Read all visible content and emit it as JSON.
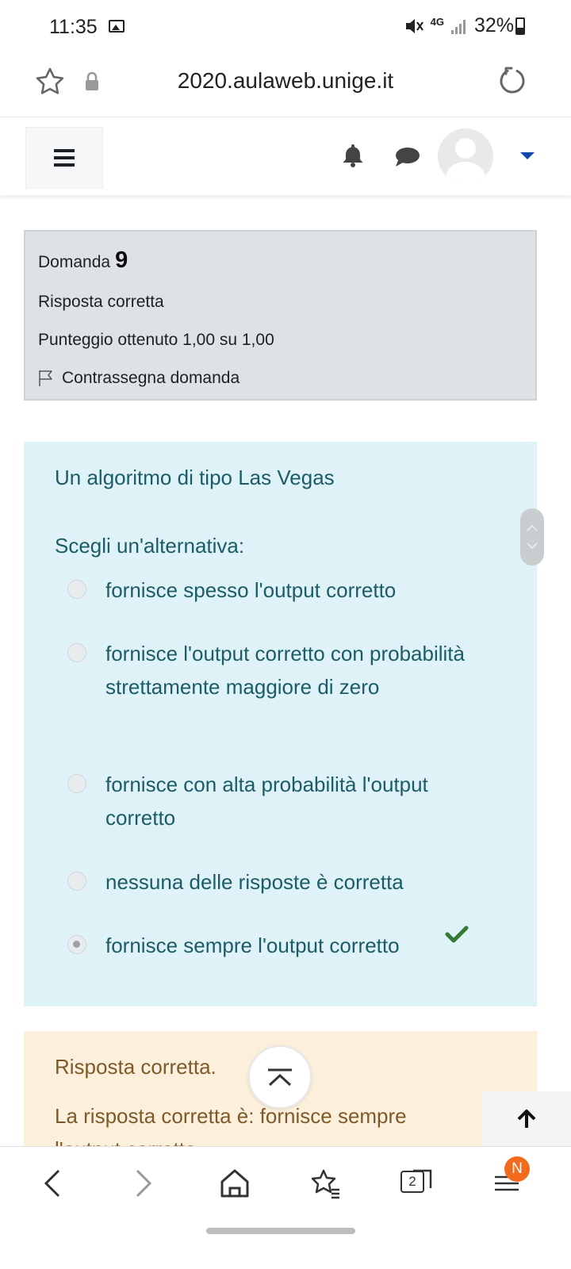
{
  "status_bar": {
    "time": "11:35",
    "network": "4G",
    "battery": "32%"
  },
  "browser": {
    "url": "2020.aulaweb.unige.it"
  },
  "question_info": {
    "label": "Domanda",
    "number": "9",
    "state": "Risposta corretta",
    "grade": "Punteggio ottenuto 1,00 su 1,00",
    "flag_label": "Contrassegna domanda"
  },
  "question": {
    "text": "Un algoritmo di tipo Las Vegas",
    "prompt": "Scegli un'alternativa:",
    "answers": [
      {
        "label": "fornisce spesso l'output corretto",
        "selected": false
      },
      {
        "label": "fornisce l'output corretto con probabilità strettamente maggiore di zero",
        "selected": false
      },
      {
        "label": "fornisce con alta probabilità l'output corretto",
        "selected": false
      },
      {
        "label": "nessuna delle risposte è corretta",
        "selected": false
      },
      {
        "label": "fornisce sempre l'output corretto",
        "selected": true
      }
    ]
  },
  "feedback": {
    "state": "Risposta corretta.",
    "right_answer": "La risposta corretta è: fornisce sempre l'output corretto"
  },
  "bottom_nav": {
    "tab_count": "2",
    "badge": "N"
  },
  "colors": {
    "info_bg": "#dee2e6",
    "question_bg": "#def2f8",
    "question_text": "#1b5c66",
    "feedback_bg": "#fcefdc",
    "feedback_text": "#7d5a29",
    "check": "#357a32",
    "badge": "#f26b1d",
    "caret": "#0f47ad"
  },
  "icons": [
    "image-icon",
    "mute-icon",
    "signal-icon",
    "battery-icon",
    "star-icon",
    "lock-icon",
    "reload-icon",
    "hamburger-icon",
    "bell-icon",
    "chat-icon",
    "user-icon",
    "caret-down-icon",
    "flag-icon",
    "check-icon",
    "chevron-up-icon",
    "arrow-up-icon",
    "back-icon",
    "forward-icon",
    "home-icon",
    "bookmarks-icon",
    "tabs-icon",
    "menu-icon"
  ]
}
